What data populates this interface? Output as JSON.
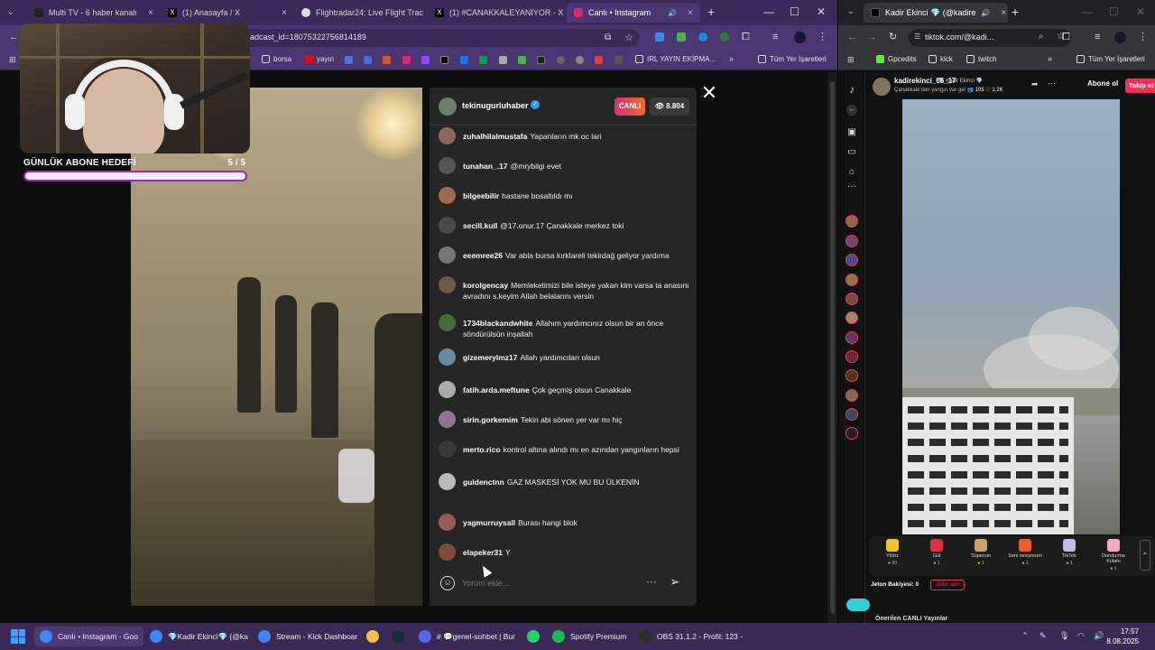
{
  "left_window": {
    "tabs": [
      {
        "label": "Multi TV - 6 haber kanalı",
        "color": "#222222"
      },
      {
        "label": "(1) Anasayfa / X",
        "color": "#000000"
      },
      {
        "label": "Flightradar24: Live Flight Trac",
        "color": "#f4f4f4"
      },
      {
        "label": "(1) #CANAKKALEYANIYOR - X",
        "color": "#000000"
      },
      {
        "label": "Canlı • Instagram",
        "color": "#d6297a"
      }
    ],
    "url": "oadcast_id=18075322756814189",
    "bookmarks": [
      "borsa",
      "yayın",
      "IRL YAYIN EKİPMA...",
      "Tüm Yer İşaretleri"
    ]
  },
  "sub_goal": {
    "title": "GÜNLÜK ABONE HEDEFİ",
    "count": "5  / 5",
    "progress": 1.0,
    "bar_color": "#a028c8"
  },
  "instagram": {
    "host": "tekinugurluhaber",
    "live_label": "CANLI",
    "viewers": "8.804",
    "comment_placeholder": "Yorum ekle...",
    "comments": [
      {
        "user": "zuhalhilalmustafa",
        "text": "Yapanların mk oc lari",
        "color": "#8a6a5a"
      },
      {
        "user": "tunahan_.17",
        "text": "@mrybilgi evet",
        "color": "#555555"
      },
      {
        "user": "bilgeebilir",
        "text": "hastane bosaltıldı mı",
        "color": "#9a6a4a"
      },
      {
        "user": "secill.kull",
        "text": "@17.onur.17 Çanakkale merkez toki",
        "color": "#4a4a4a"
      },
      {
        "user": "eeemree26",
        "text": "Var abla bursa kırklareli tekirdağ geliyor yardıma",
        "color": "#777777"
      },
      {
        "user": "korolgencay",
        "text": "Memleketimizi bile isteye yakan kim varsa ta anasını avradını s.keyim Allah belalarını versin",
        "color": "#6a5a4a"
      },
      {
        "user": "1734blackandwhite",
        "text": "Allahım yardımcınız olsun bir an önce söndürülsün inşallah",
        "color": "#4a6a3a"
      },
      {
        "user": "gizemerylmz17",
        "text": "Allah yardımcıları olsun",
        "color": "#6a8aa0"
      },
      {
        "user": "fatih.arda.meftune",
        "text": "Çok geçmiş olsun Canakkale",
        "color": "#aaaaaa"
      },
      {
        "user": "sirin.gorkemim",
        "text": "Tekin abi sönen yer var mı hiç",
        "color": "#8a7a8a"
      },
      {
        "user": "merto.rico",
        "text": "kontrol altına alındı mı en azından yangınların hepsi",
        "color": "#3a3a3a"
      },
      {
        "user": "guldenctnn",
        "text": "GAZ MASKESİ YOK MU BU ÜLKENİN",
        "color": "#bbbbbb"
      },
      {
        "user": "yagmurruysall",
        "text": "Burası hangi blok",
        "color": "#9a5a5a"
      },
      {
        "user": "elapeker31",
        "text": "Y",
        "color": "#7a4a3a"
      }
    ]
  },
  "right_window": {
    "tab_label": "Kadir Ekinci 💎 (@kadire",
    "url": "tiktok.com/@kadi...",
    "bookmarks": [
      "Gpcedits",
      "kick",
      "twitch",
      "Tüm Yer İşaretleri"
    ]
  },
  "tiktok": {
    "host": "kadirekinci_65_17",
    "host_tag": "💎 Kadir Ekinci 💎",
    "subtitle": "Çanakkale'den yangın var gel",
    "stats": "👥 105  ♡ 1.2K",
    "subscribe": "Abone ol",
    "follow": "Takip et",
    "gifts": [
      {
        "name": "Yıldız",
        "cost": "99",
        "color": "#f2c12e"
      },
      {
        "name": "Gül",
        "cost": "1",
        "color": "#e2304a"
      },
      {
        "name": "Süpersin",
        "cost": "1",
        "color": "#c8a070"
      },
      {
        "name": "Seni seviyorum",
        "cost": "1",
        "color": "#f05a2a"
      },
      {
        "name": "TikTok",
        "cost": "1",
        "color": "#c8b8f0"
      },
      {
        "name": "Dondurma Külahı",
        "cost": "1",
        "color": "#f4a8c4"
      }
    ],
    "balance": "Jeton Bakiyesi: 0",
    "recharge": "Jeton alın",
    "suggested": "Önerilen CANLI Yayınlar"
  },
  "taskbar": {
    "items": [
      {
        "label": "Canlı • Instagram - Goo",
        "color": "#4285f4",
        "active": true
      },
      {
        "label": "💎Kadir Ekinci💎 (@ka",
        "color": "#4285f4",
        "active": false
      },
      {
        "label": "Stream - Kick Dashboar",
        "color": "#4285f4",
        "active": false
      },
      {
        "label": "",
        "color": "#f2c14e",
        "active": false
      },
      {
        "label": "",
        "color": "#1b2838",
        "active": false
      },
      {
        "label": "# 💬genel-sohbet | Bur",
        "color": "#5865f2",
        "active": false
      },
      {
        "label": "",
        "color": "#25d366",
        "active": false
      },
      {
        "label": "Spotify Premium",
        "color": "#1db954",
        "active": false
      },
      {
        "label": "OBS 31.1.2 - Profil: 123 -",
        "color": "#302e31",
        "active": false
      }
    ],
    "time": "17:57",
    "date": "8.08.2025"
  }
}
